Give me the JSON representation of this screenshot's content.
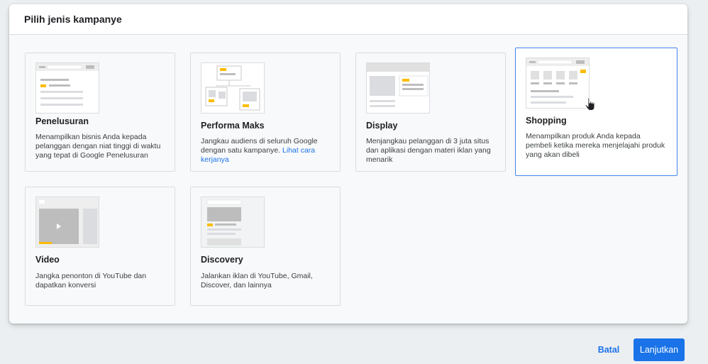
{
  "dialog": {
    "title": "Pilih jenis kampanye"
  },
  "campaigns": [
    {
      "id": "search",
      "title": "Penelusuran",
      "description": "Menampilkan bisnis Anda kepada pelanggan dengan niat tinggi di waktu yang tepat di Google Penelusuran",
      "selected": false
    },
    {
      "id": "pmax",
      "title": "Performa Maks",
      "description": "Jangkau audiens di seluruh Google dengan satu kampanye.",
      "link": "Lihat cara kerjanya",
      "selected": false
    },
    {
      "id": "display",
      "title": "Display",
      "description": "Menjangkau pelanggan di 3 juta situs dan aplikasi dengan materi iklan yang menarik",
      "selected": false
    },
    {
      "id": "shopping",
      "title": "Shopping",
      "description": "Menampilkan produk Anda kepada pembeli ketika mereka menjelajahi produk yang akan dibeli",
      "selected": true
    },
    {
      "id": "video",
      "title": "Video",
      "description": "Jangka penonton di YouTube dan dapatkan konversi",
      "selected": false
    },
    {
      "id": "discovery",
      "title": "Discovery",
      "description": "Jalankan iklan di YouTube, Gmail, Discover, dan lainnya",
      "selected": false
    }
  ],
  "footer": {
    "cancel_label": "Batal",
    "continue_label": "Lanjutkan"
  },
  "colors": {
    "accent": "#1a73e8",
    "selected_border": "#4285f4",
    "thumb_highlight": "#fbbc04"
  }
}
